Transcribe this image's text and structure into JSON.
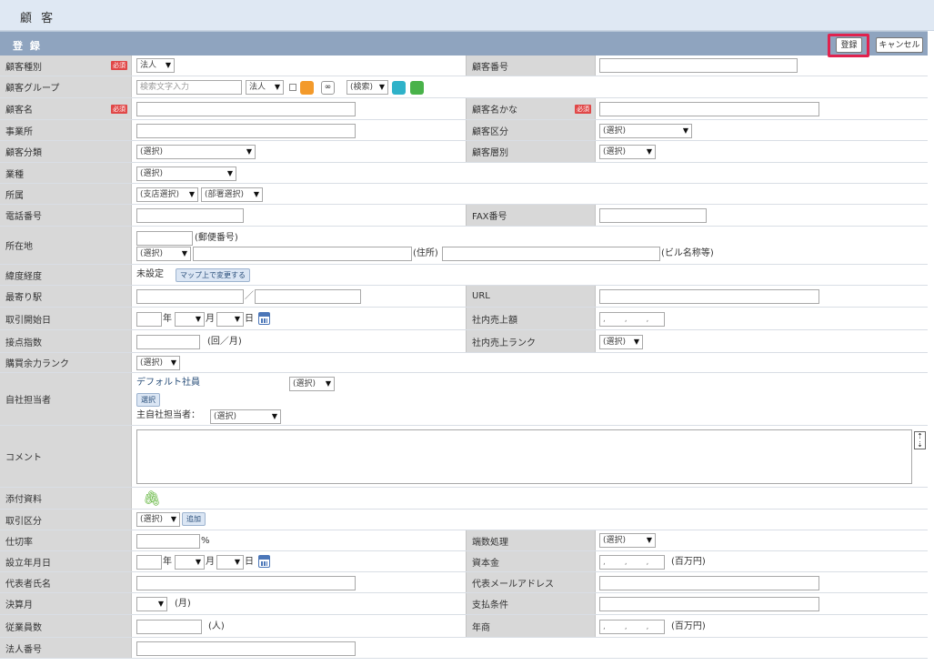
{
  "title": "顧 客",
  "section_title": "登 録",
  "actions": {
    "register": "登録",
    "cancel": "キャンセル"
  },
  "required_badge": "必須",
  "fields": {
    "customer_type": {
      "label": "顧客種別",
      "value": "法人"
    },
    "customer_number": {
      "label": "顧客番号"
    },
    "customer_group": {
      "label": "顧客グループ",
      "search_placeholder": "検索文字入力",
      "type_value": "法人",
      "mode_value": "(検索)"
    },
    "customer_name": {
      "label": "顧客名"
    },
    "customer_name_kana": {
      "label": "顧客名かな"
    },
    "office": {
      "label": "事業所"
    },
    "customer_category": {
      "label": "顧客区分",
      "value": "(選択)"
    },
    "customer_class": {
      "label": "顧客分類",
      "value": "(選択)"
    },
    "customer_tier": {
      "label": "顧客層別",
      "value": "(選択)"
    },
    "industry": {
      "label": "業種",
      "value": "(選択)"
    },
    "affiliation": {
      "label": "所属",
      "branch_value": "(支店選択)",
      "dept_value": "(部署選択)"
    },
    "phone": {
      "label": "電話番号"
    },
    "fax": {
      "label": "FAX番号"
    },
    "address": {
      "label": "所在地",
      "postal_label": "(郵便番号)",
      "pref_value": "(選択)",
      "address_label": "(住所)",
      "building_label": "(ビル名称等)"
    },
    "latlng": {
      "label": "緯度経度",
      "value": "未設定",
      "button": "マップ上で変更する"
    },
    "nearest_station": {
      "label": "最寄り駅",
      "separator": "／"
    },
    "url": {
      "label": "URL"
    },
    "start_date": {
      "label": "取引開始日",
      "year": "年",
      "month": "月",
      "day": "日"
    },
    "internal_sales": {
      "label": "社内売上額",
      "placeholder": ", , ,"
    },
    "contact_index": {
      "label": "接点指数",
      "unit": "(回／月)"
    },
    "internal_sales_rank": {
      "label": "社内売上ランク",
      "value": "(選択)"
    },
    "purchase_rank": {
      "label": "購買余力ランク",
      "value": "(選択)"
    },
    "staff": {
      "label": "自社担当者",
      "default_staff": "デフォルト社員",
      "value": "(選択)",
      "select_button": "選択",
      "main_label": "主自社担当者：",
      "main_value": "(選択)"
    },
    "comment": {
      "label": "コメント"
    },
    "attachment": {
      "label": "添付資料"
    },
    "trade_category": {
      "label": "取引区分",
      "value": "(選択)",
      "add_button": "追加"
    },
    "cut_rate": {
      "label": "仕切率",
      "unit": "%"
    },
    "rounding": {
      "label": "端数処理",
      "value": "(選択)"
    },
    "established": {
      "label": "設立年月日",
      "year": "年",
      "month": "月",
      "day": "日"
    },
    "capital": {
      "label": "資本金",
      "placeholder": ", , ,",
      "unit": "(百万円)"
    },
    "representative": {
      "label": "代表者氏名"
    },
    "rep_email": {
      "label": "代表メールアドレス"
    },
    "fiscal_month": {
      "label": "決算月",
      "unit": "(月)"
    },
    "payment_terms": {
      "label": "支払条件"
    },
    "employees": {
      "label": "従業員数",
      "unit": "(人)"
    },
    "annual_sales": {
      "label": "年商",
      "placeholder": ", , ,",
      "unit": "(百万円)"
    },
    "corporate_number": {
      "label": "法人番号"
    }
  },
  "colors": {
    "label_bg": "#d8d8d8",
    "section_bar": "#8fa4bf",
    "title_bar": "#dfe8f3",
    "highlight": "#e0224e",
    "required": "#e04848"
  }
}
